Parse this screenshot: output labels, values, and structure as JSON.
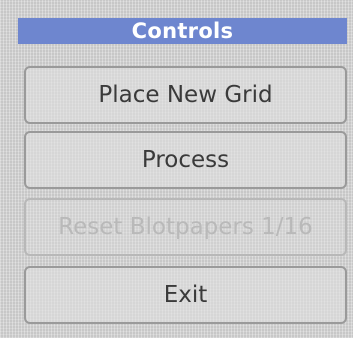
{
  "window": {
    "title": "Controls"
  },
  "buttons": {
    "place_new_grid": "Place New Grid",
    "process": "Process",
    "reset_blotpapers": "Reset Blotpapers 1/16",
    "exit": "Exit"
  },
  "colors": {
    "header_background": "#6e86cf",
    "header_text": "#ffffff",
    "panel_background": "#d6d6d6",
    "button_text": "#3a3a3a",
    "disabled_text": "#b9b9b9"
  },
  "state": {
    "reset_blotpapers_enabled": false
  }
}
